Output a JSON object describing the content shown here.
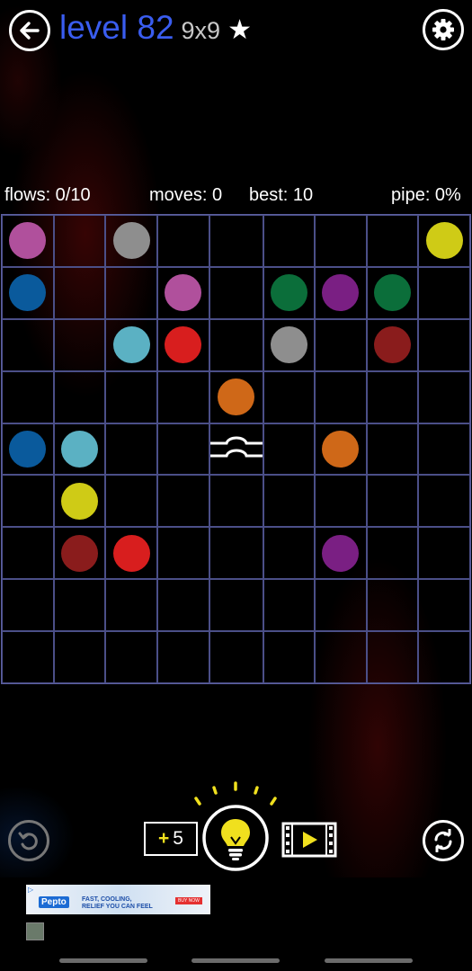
{
  "header": {
    "level_label": "level 82",
    "size_label": "9x9",
    "star": "★",
    "back_icon": "arrow-left-icon",
    "settings_icon": "gear-icon"
  },
  "stats": {
    "flows": "flows: 0/10",
    "moves": "moves: 0",
    "best": "best: 10",
    "pipe": "pipe: 0%"
  },
  "board": {
    "cols": 9,
    "rows": 9,
    "colors": {
      "pink": "#b0509c",
      "gray": "#8e8e8e",
      "yellow": "#cfcb16",
      "blue": "#0a5a9c",
      "green": "#0b6e3a",
      "purple": "#7a1f83",
      "cyan": "#5bb1c3",
      "red": "#d81e1e",
      "darkred": "#8a1c1c",
      "orange": "#cf6818"
    },
    "dots": [
      {
        "row": 0,
        "col": 0,
        "color": "pink"
      },
      {
        "row": 0,
        "col": 2,
        "color": "gray"
      },
      {
        "row": 0,
        "col": 8,
        "color": "yellow"
      },
      {
        "row": 1,
        "col": 0,
        "color": "blue"
      },
      {
        "row": 1,
        "col": 3,
        "color": "pink"
      },
      {
        "row": 1,
        "col": 5,
        "color": "green"
      },
      {
        "row": 1,
        "col": 6,
        "color": "purple"
      },
      {
        "row": 1,
        "col": 7,
        "color": "green"
      },
      {
        "row": 2,
        "col": 2,
        "color": "cyan"
      },
      {
        "row": 2,
        "col": 3,
        "color": "red"
      },
      {
        "row": 2,
        "col": 5,
        "color": "gray"
      },
      {
        "row": 2,
        "col": 7,
        "color": "darkred"
      },
      {
        "row": 3,
        "col": 4,
        "color": "orange"
      },
      {
        "row": 4,
        "col": 0,
        "color": "blue"
      },
      {
        "row": 4,
        "col": 1,
        "color": "cyan"
      },
      {
        "row": 4,
        "col": 6,
        "color": "orange"
      },
      {
        "row": 5,
        "col": 1,
        "color": "yellow"
      },
      {
        "row": 6,
        "col": 1,
        "color": "darkred"
      },
      {
        "row": 6,
        "col": 2,
        "color": "red"
      },
      {
        "row": 6,
        "col": 6,
        "color": "purple"
      }
    ],
    "bridges": [
      {
        "row": 4,
        "col": 4,
        "icon": "bridge-icon"
      }
    ]
  },
  "controls": {
    "undo_icon": "undo-icon",
    "hint_plus": "+",
    "hint_count": "5",
    "hint_icon": "lightbulb-icon",
    "video_icon": "video-play-icon",
    "refresh_icon": "refresh-icon"
  },
  "ad": {
    "tag": "▷",
    "brand": "Pepto",
    "copy_line1": "FAST, COOLING,",
    "copy_line2": "RELIEF YOU CAN FEEL",
    "cta": "BUY NOW"
  }
}
